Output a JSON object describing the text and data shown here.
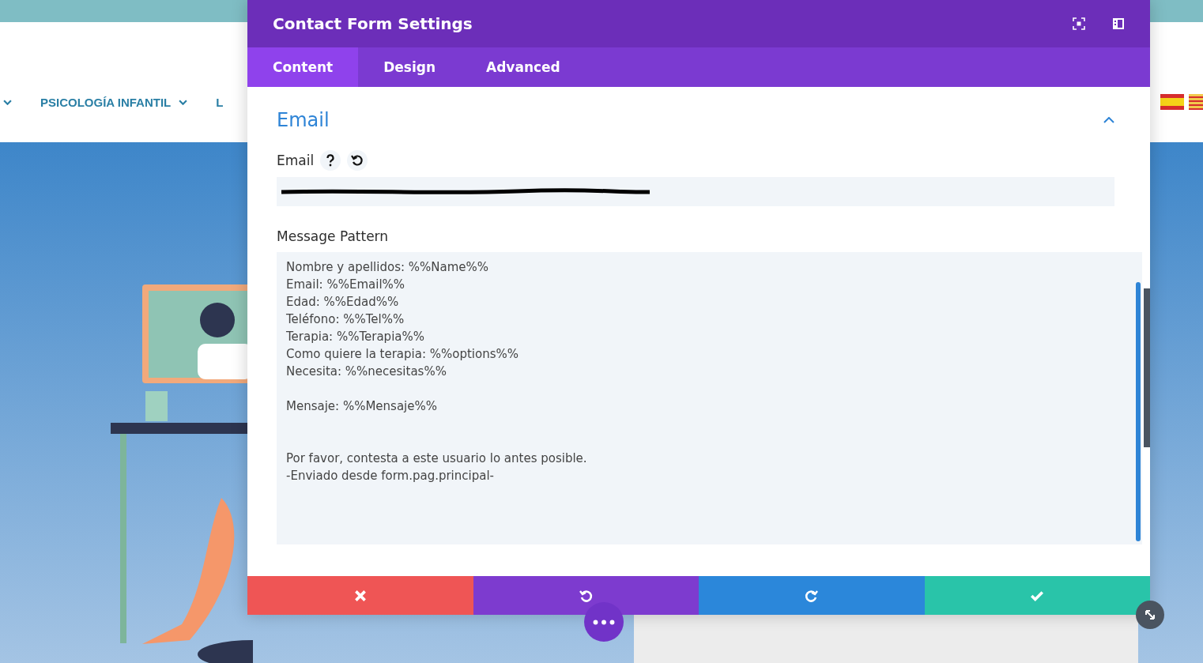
{
  "site_nav": {
    "items": [
      {
        "label": "PSICOLOGÍA INFANTIL",
        "has_dropdown": true
      },
      {
        "label": "L",
        "has_dropdown": false
      }
    ]
  },
  "modal": {
    "title": "Contact Form Settings",
    "tabs": [
      {
        "label": "Content",
        "selected": true
      },
      {
        "label": "Design",
        "selected": false
      },
      {
        "label": "Advanced",
        "selected": false
      }
    ],
    "section": {
      "title": "Email",
      "expanded": true
    },
    "email_field": {
      "label": "Email"
    },
    "message_field": {
      "label": "Message Pattern",
      "value": "Nombre y apellidos: %%Name%%\nEmail: %%Email%%\nEdad: %%Edad%%\nTeléfono: %%Tel%%\nTerapia: %%Terapia%%\nComo quiere la terapia: %%options%%\nNecesita: %%necesitas%%\n\nMensaje: %%Mensaje%%\n\n\nPor favor, contesta a este usuario lo antes posible.\n-Enviado desde form.pag.principal-"
    },
    "footer_buttons": [
      {
        "kind": "cancel"
      },
      {
        "kind": "undo"
      },
      {
        "kind": "redo"
      },
      {
        "kind": "save"
      }
    ]
  }
}
